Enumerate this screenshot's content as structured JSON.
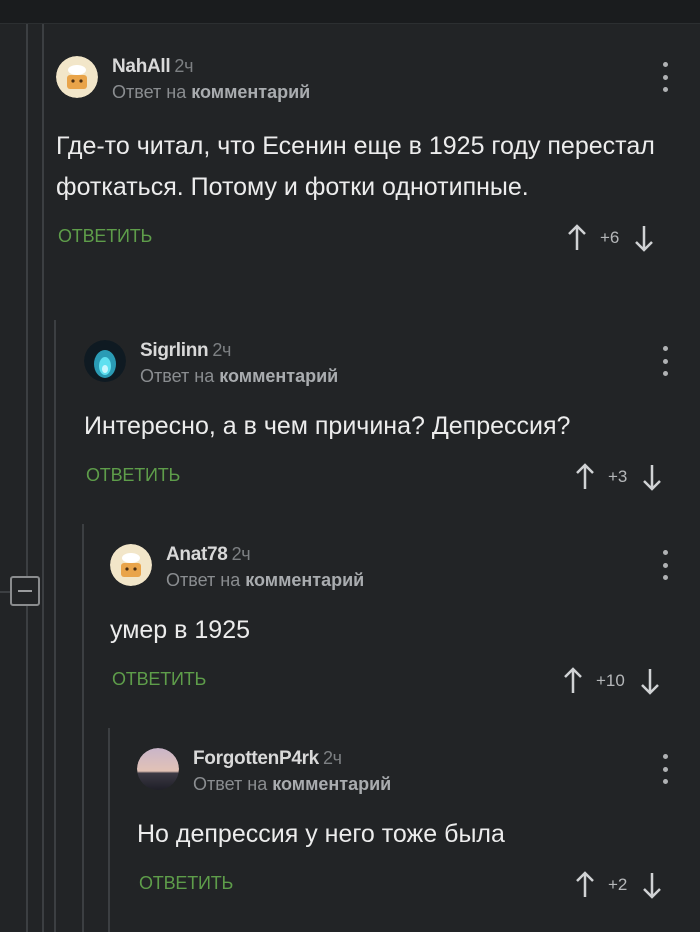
{
  "reply_prefix": "Ответ на",
  "reply_target": "комментарий",
  "reply_button": "ОТВЕТИТЬ",
  "comments": [
    {
      "author": "NahAll",
      "time": "2ч",
      "text": "Где-то читал, что Есенин еще в 1925 году перестал фоткаться. Потому и фотки однотипные.",
      "score": "+6",
      "avatar": "chef-avatar-icon"
    },
    {
      "author": "Sigrlinn",
      "time": "2ч",
      "text": "Интересно, а в чем причина? Депрессия?",
      "score": "+3",
      "avatar": "blue-flame-avatar-icon"
    },
    {
      "author": "Anat78",
      "time": "2ч",
      "text": "умер в 1925",
      "score": "+10",
      "avatar": "chef-avatar-icon"
    },
    {
      "author": "ForgottenP4rk",
      "time": "2ч",
      "text": "Но депрессия у него тоже была",
      "score": "+2",
      "avatar": "sunset-avatar-icon"
    }
  ],
  "colors": {
    "background": "#222426",
    "reply_green": "#5e9d4a",
    "thread_line": "#3c3f42"
  }
}
